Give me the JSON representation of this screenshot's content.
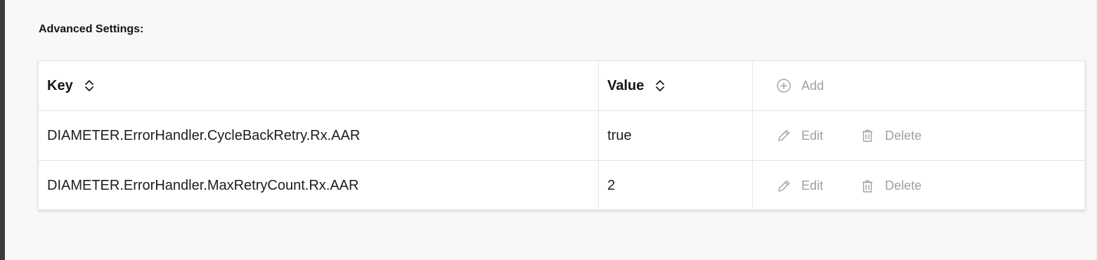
{
  "section_title": "Advanced Settings:",
  "table": {
    "headers": {
      "key": "Key",
      "value": "Value",
      "add_label": "Add"
    },
    "rows": [
      {
        "key": "DIAMETER.ErrorHandler.CycleBackRetry.Rx.AAR",
        "value": "true",
        "edit_label": "Edit",
        "delete_label": "Delete"
      },
      {
        "key": "DIAMETER.ErrorHandler.MaxRetryCount.Rx.AAR",
        "value": "2",
        "edit_label": "Edit",
        "delete_label": "Delete"
      }
    ]
  },
  "colors": {
    "page_background": "#f9f8f6",
    "text": "#161513",
    "muted_action": "#a3a09b",
    "border": "#e6e4e0"
  },
  "icons": {
    "sort": "sort-updown-icon",
    "add": "add-circle-icon",
    "edit": "pencil-icon",
    "delete": "trash-icon"
  }
}
